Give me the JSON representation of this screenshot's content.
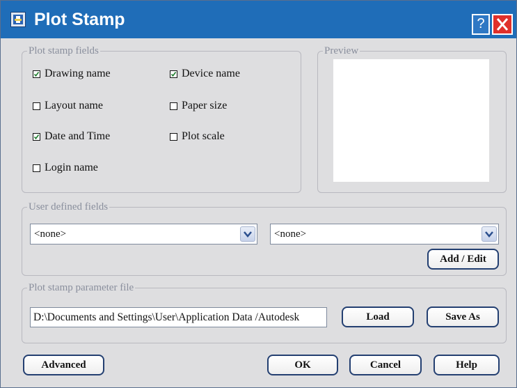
{
  "window": {
    "title": "Plot Stamp",
    "help_symbol": "?",
    "icons": {
      "app": "plot-stamp-app-icon",
      "help": "help-icon",
      "close": "close-icon"
    },
    "colors": {
      "titlebar": "#1f6db8",
      "close": "#e0302b",
      "body": "#dedee0"
    }
  },
  "fields_group": {
    "legend": "Plot stamp fields",
    "checkboxes": [
      {
        "label": "Drawing name",
        "checked": true
      },
      {
        "label": "Device name",
        "checked": true
      },
      {
        "label": "Layout name",
        "checked": false
      },
      {
        "label": "Paper size",
        "checked": false
      },
      {
        "label": "Date and Time",
        "checked": true
      },
      {
        "label": "Plot scale",
        "checked": false
      },
      {
        "label": "Login name",
        "checked": false
      }
    ]
  },
  "preview_group": {
    "legend": "Preview"
  },
  "user_group": {
    "legend": "User defined fields",
    "select1": "<none>",
    "select2": "<none>",
    "add_edit": "Add / Edit"
  },
  "param_group": {
    "legend": "Plot stamp parameter file",
    "path": "D:\\Documents and Settings\\User\\Application Data /Autodesk",
    "load": "Load",
    "save_as": "Save As"
  },
  "footer": {
    "advanced": "Advanced",
    "ok": "OK",
    "cancel": "Cancel",
    "help": "Help"
  }
}
